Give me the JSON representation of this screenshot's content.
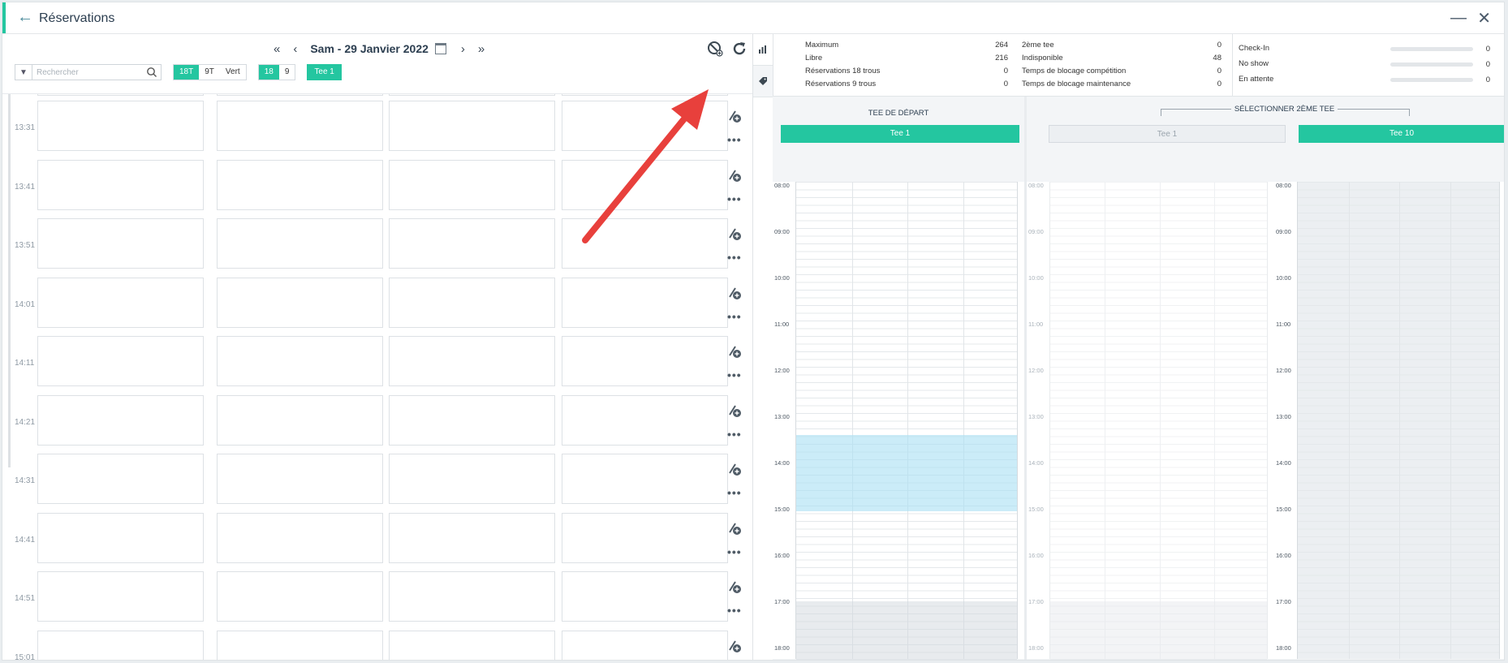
{
  "window": {
    "title": "Réservations"
  },
  "datenav": {
    "first": "«",
    "prev": "‹",
    "date": "Sam - 29 Janvier 2022",
    "next": "›",
    "last": "»"
  },
  "search": {
    "placeholder": "Rechercher"
  },
  "filters": {
    "holes_type": [
      {
        "label": "18T",
        "active": true
      },
      {
        "label": "9T",
        "active": false
      },
      {
        "label": "Vert",
        "active": false
      }
    ],
    "holes": [
      {
        "label": "18",
        "active": true
      },
      {
        "label": "9",
        "active": false
      }
    ],
    "tee": "Tee 1"
  },
  "slots": {
    "times": [
      "13:31",
      "13:41",
      "13:51",
      "14:01",
      "14:11",
      "14:21",
      "14:31",
      "14:41",
      "14:51",
      "15:01"
    ],
    "more_label": "•••"
  },
  "stats": {
    "col1": [
      {
        "label": "Maximum",
        "value": "264"
      },
      {
        "label": "Libre",
        "value": "216"
      },
      {
        "label": "Réservations 18 trous",
        "value": "0"
      },
      {
        "label": "Réservations 9 trous",
        "value": "0"
      }
    ],
    "col2": [
      {
        "label": "2ème tee",
        "value": "0"
      },
      {
        "label": "Indisponible",
        "value": "48"
      },
      {
        "label": "Temps de blocage compétition",
        "value": "0"
      },
      {
        "label": "Temps de blocage maintenance",
        "value": "0"
      }
    ],
    "col3": [
      {
        "label": "Check-In",
        "value": "0",
        "progress": 0
      },
      {
        "label": "No show",
        "value": "0",
        "progress": 0
      },
      {
        "label": "En attente",
        "value": "0",
        "progress": 0
      }
    ]
  },
  "tee_start": {
    "heading": "TEE DE DÉPART",
    "tee": "Tee 1"
  },
  "second_tee": {
    "heading": "SÉLECTIONNER 2ÈME TEE",
    "tees": [
      "Tee 1",
      "Tee 10"
    ]
  },
  "hours": [
    "08:00",
    "09:00",
    "10:00",
    "11:00",
    "12:00",
    "13:00",
    "14:00",
    "15:00",
    "16:00",
    "17:00",
    "18:00"
  ],
  "colors": {
    "accent": "#24c6a0",
    "highlight": "#cdeefa",
    "annotation_arrow": "#e8403c"
  }
}
